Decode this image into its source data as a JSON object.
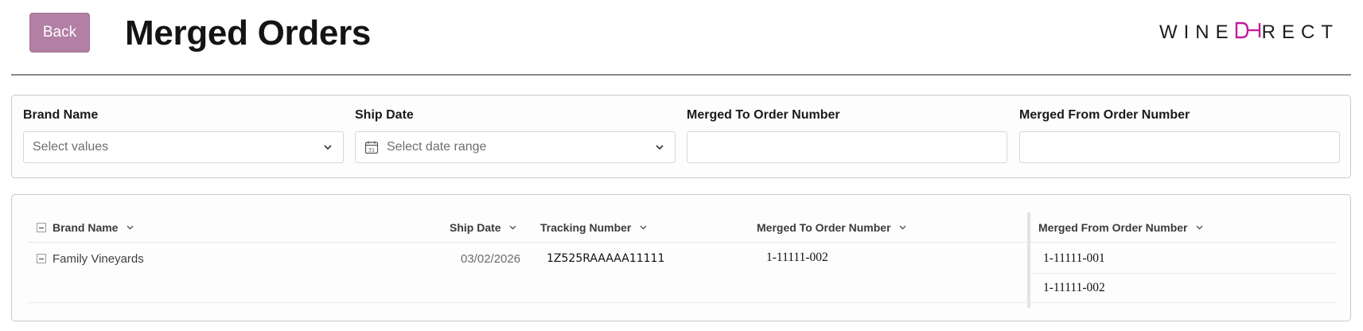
{
  "header": {
    "back_label": "Back",
    "title": "Merged Orders",
    "logo_text_left": "WINE",
    "logo_mark": "DH",
    "logo_text_right": "RECT"
  },
  "colors": {
    "accent": "#b27fa5",
    "brand_mark": "#c21b9c",
    "title": "#141414"
  },
  "filters": [
    {
      "label": "Brand Name",
      "placeholder": "Select values",
      "type": "multiselect",
      "icon": "chevron-down-icon"
    },
    {
      "label": "Ship Date",
      "placeholder": "Select date range",
      "type": "daterange",
      "icon": "calendar-icon"
    },
    {
      "label": "Merged To Order Number",
      "value": "",
      "type": "text"
    },
    {
      "label": "Merged From Order Number",
      "value": "",
      "type": "text"
    }
  ],
  "grid": {
    "columns": [
      "Brand Name",
      "Ship Date",
      "Tracking Number",
      "Merged To Order Number",
      "Merged From Order Number"
    ],
    "rows": [
      {
        "brand_name": "Family Vineyards",
        "ship_date": "03/02/2026",
        "tracking_number": "1Z525RAAAAA11111",
        "merged_to": "1-11111-002",
        "merged_from": [
          "1-11111-001",
          "1-11111-002"
        ]
      }
    ]
  }
}
